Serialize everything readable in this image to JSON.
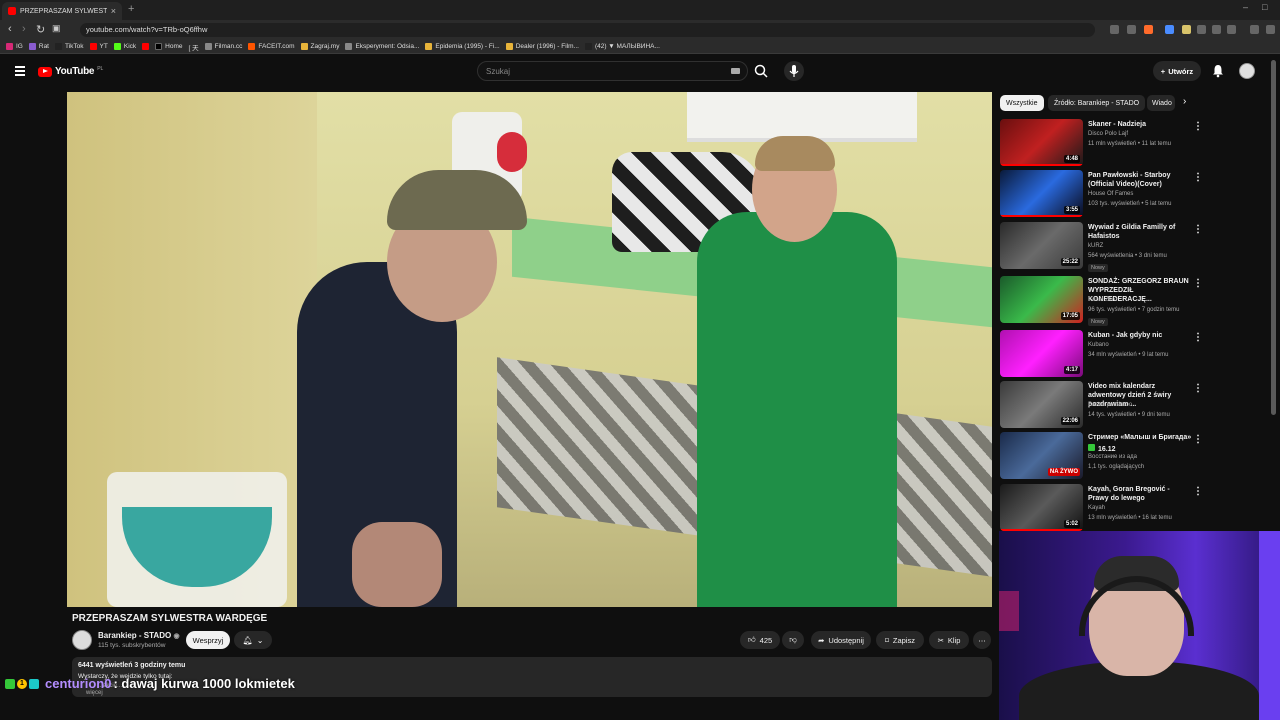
{
  "browser": {
    "tab_title": "PRZEPRASZAM SYLWESTRA WARDĘGE",
    "url": "youtube.com/watch?v=TRb-oQ6ffhw",
    "bookmarks": [
      "IG",
      "Rat",
      "TikTok",
      "YT",
      "Kick",
      "Home",
      "[ 天",
      "Filman.cc",
      "FACEIT.com",
      "Zagraj.my",
      "Eksperyment: Odsia...",
      "Epidemia (1995) - Fi...",
      "Dealer (1996) - Film...",
      "(42) ▼ МАЛЫВИНА..."
    ]
  },
  "youtube": {
    "logo_text": "YouTube",
    "country_code": "PL",
    "search_placeholder": "Szukaj",
    "create_label": "Utwórz"
  },
  "video": {
    "title": "PRZEPRASZAM SYLWESTRA WARDĘGE",
    "channel": "Barankiep - STADO",
    "subscribers": "115 tys. subskrybentów",
    "support_label": "Wesprzyj",
    "likes": "425",
    "share_label": "Udostępnij",
    "save_label": "Zapisz",
    "clip_label": "Klip",
    "views_time": "6441 wyświetleń  3 godziny temu",
    "desc_line1": "Wystarczy, że wejdzie tylko tutaj:",
    "desc_line2": "...akcie...",
    "desc_line3": "więcej"
  },
  "chat": {
    "badge": "1",
    "user": "centurion0",
    "message": ": dawaj kurwa 1000 lokmietek"
  },
  "sidebar": {
    "chips": [
      "Wszystkie",
      "Źródło: Barankiep - STADO",
      "Wiado"
    ],
    "items": [
      {
        "title": "Skaner - Nadzieja",
        "channel": "Disco Polo Lajf",
        "meta": "11 mln wyświetleń • 11 lat temu",
        "duration": "4:48",
        "thumb": "#8a1a1a"
      },
      {
        "title": "Pan Pawłowski - Starboy (Official Video)(Cover)",
        "channel": "House Of Fames",
        "meta": "103 tys. wyświetleń • 5 lat temu",
        "duration": "3:55",
        "thumb": "#1a3a6a"
      },
      {
        "title": "Wywiad z Gildia Familly of Hafaistos",
        "channel": "kURZ",
        "meta": "564 wyświetlenia • 3 dni temu",
        "duration": "25:22",
        "badge": "Nowy",
        "thumb": "#5a5a5a"
      },
      {
        "title": "SONDAŻ: GRZEGORZ BRAUN WYPRZEDZIŁ KONFEDERACJĘ...",
        "channel": "Kanał Zero",
        "meta": "96 tys. wyświetleń • 7 godzin temu",
        "duration": "17:05",
        "badge": "Nowy",
        "thumb": "#2a8a3a"
      },
      {
        "title": "Kuban - Jak gdyby nic",
        "channel": "Kubano",
        "meta": "34 mln wyświetleń • 9 lat temu",
        "duration": "4:17",
        "thumb": "#d01ad0"
      },
      {
        "title": "Video mix kalendarz adwentowy dzień 2 świry pozdrawiam ...",
        "channel": "Bartek pozdrooo",
        "meta": "14 tys. wyświetleń • 9 dni temu",
        "duration": "22:06",
        "thumb": "#4a4a4a"
      },
      {
        "title": "Стример «Малыш и Бригада»",
        "channel": "Восстание из ада",
        "meta": "1,1 tys. oglądających",
        "live_label": "NA ŻYWO",
        "extra": "16.12",
        "thumb": "#3a4a6a"
      },
      {
        "title": "Kayah, Goran Bregović - Prawy do lewego",
        "channel": "Kayah",
        "meta": "13 mln wyświetleń • 16 lat temu",
        "duration": "5:02",
        "thumb": "#3a3a3a"
      }
    ]
  }
}
